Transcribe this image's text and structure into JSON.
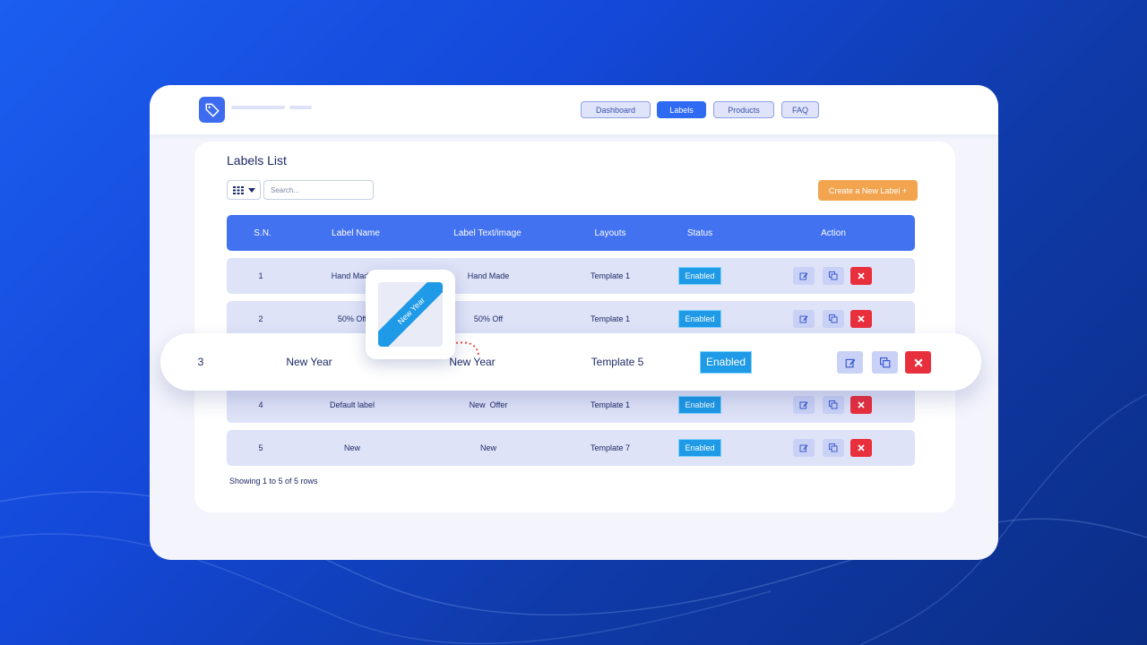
{
  "nav": {
    "items": [
      {
        "label": "Dashboard",
        "active": false
      },
      {
        "label": "Labels",
        "active": true
      },
      {
        "label": "Products",
        "active": false
      },
      {
        "label": "FAQ",
        "active": false
      }
    ]
  },
  "page": {
    "title": "Labels List",
    "search_placeholder": "Search...",
    "create_button": "Create a New Label +",
    "footer": "Showing 1 to 5 of 5 rows"
  },
  "table": {
    "headers": [
      "S.N.",
      "Label Name",
      "Label Text/image",
      "Layouts",
      "Status",
      "Action"
    ],
    "rows": [
      {
        "sn": "1",
        "name": "Hand Made",
        "text": "Hand Made",
        "layout": "Template 1",
        "status": "Enabled"
      },
      {
        "sn": "2",
        "name": "50% Off",
        "text": "50% Off",
        "layout": "Template 1",
        "status": "Enabled"
      },
      {
        "sn": "3",
        "name": "New Year",
        "text": "New Year",
        "layout": "Template 5",
        "status": "Enabled"
      },
      {
        "sn": "4",
        "name": "Default label",
        "text": "New  Offer",
        "layout": "Template 1",
        "status": "Enabled"
      },
      {
        "sn": "5",
        "name": "New",
        "text": "New",
        "layout": "Template 7",
        "status": "Enabled"
      }
    ]
  },
  "preview": {
    "ribbon_text": "New Year"
  },
  "icons": {
    "logo": "tag-icon",
    "view": "grid-icon",
    "dropdown": "caret-down-icon",
    "edit": "edit-icon",
    "copy": "copy-icon",
    "delete": "close-icon"
  },
  "colors": {
    "accent": "#4272f0",
    "status": "#1e9ae6",
    "create": "#f2a44f",
    "delete": "#e8303d"
  }
}
